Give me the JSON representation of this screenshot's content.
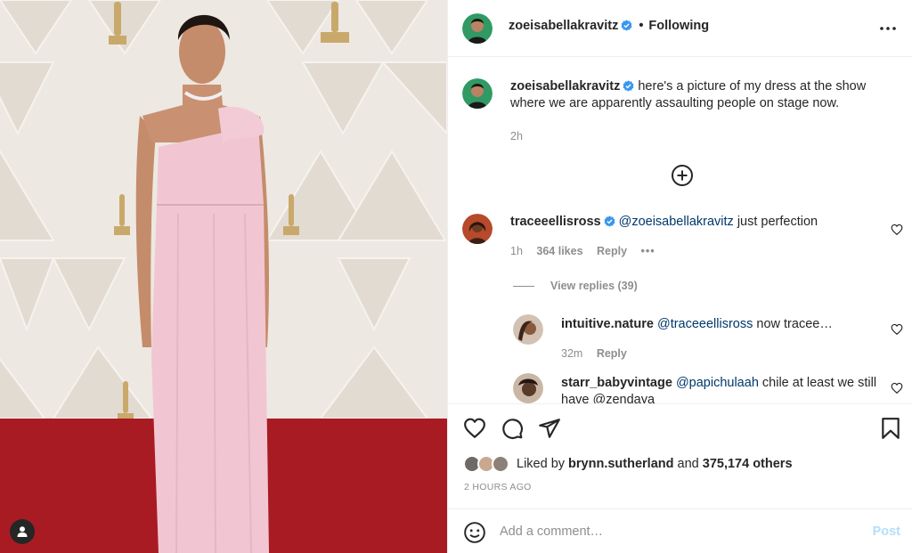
{
  "colors": {
    "accent": "#0095f6",
    "verified": "#3897f0",
    "text": "#262626",
    "muted": "#8e8e8e",
    "link": "#00376b",
    "post_disabled": "#b2dffc"
  },
  "header": {
    "username": "zoeisabellakravitz",
    "separator": "•",
    "follow_status": "Following",
    "more_icon": "more-horizontal-icon"
  },
  "caption": {
    "username": "zoeisabellakravitz",
    "text": "here's a picture of my dress at the show where we are apparently assaulting people on stage now.",
    "time": "2h"
  },
  "load_more_icon": "plus-circle-icon",
  "comments": [
    {
      "username": "traceeellisross",
      "verified": true,
      "mention": "@zoeisabellakravitz",
      "text": "just perfection",
      "time": "1h",
      "likes": "364 likes",
      "reply_label": "Reply",
      "options": "•••"
    }
  ],
  "view_replies": "View replies (39)",
  "replies": [
    {
      "username": "intuitive.nature",
      "mention": "@traceeellisross",
      "text": "now tracee…",
      "time": "32m",
      "reply_label": "Reply"
    },
    {
      "username": "starr_babyvintage",
      "mention": "@papichulaah",
      "text": "chile at least we still have @zendaya",
      "time": "",
      "reply_label": ""
    }
  ],
  "actions": {
    "like_icon": "heart-icon",
    "comment_icon": "comment-icon",
    "share_icon": "send-icon",
    "save_icon": "bookmark-icon"
  },
  "likes": {
    "prefix": "Liked by",
    "user": "brynn.sutherland",
    "middle": "and",
    "others": "375,174 others"
  },
  "timestamp": "2 HOURS AGO",
  "add_comment": {
    "placeholder": "Add a comment…",
    "post_label": "Post",
    "emoji_icon": "emoji-icon"
  }
}
